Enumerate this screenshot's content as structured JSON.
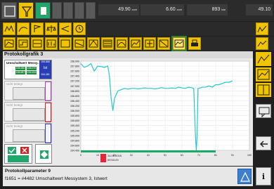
{
  "topbar": {
    "readout1": "49.90",
    "readout1_unit": "ccm",
    "readout2": "6.60",
    "readout2_unit": "ccm",
    "readout3": "893",
    "readout3_unit": "bar",
    "readout4": "49.10"
  },
  "title": "Protokollgrafik 3",
  "legend": {
    "title": "Umschaltwert Messy...",
    "v1": "155.380",
    "v2": "155.687",
    "v3": "158.570",
    "v4": "154.433",
    "badge_top": "155.888",
    "badge_mid": "Ist",
    "badge_bot": "154.481"
  },
  "cards": [
    {
      "label": "nicht belegt",
      "color": "#b03cc0"
    },
    {
      "label": "nicht belegt",
      "color": "#cc2222"
    },
    {
      "label": "nicht belegt",
      "color": "#3a3acc"
    }
  ],
  "chart": {
    "yticks": [
      "158.000",
      "157.800",
      "157.600",
      "157.400",
      "157.200",
      "157.000",
      "156.800",
      "156.600",
      "156.400",
      "156.200",
      "156.000",
      "155.800",
      "155.600",
      "155.400",
      "155.200",
      "155.000",
      "154.800",
      "154.600",
      "154.400"
    ],
    "xticks": [
      "0",
      "13",
      "21",
      "31",
      "41",
      "51",
      "61",
      "71",
      "81",
      "91",
      "100"
    ],
    "x_last": "100",
    "marker_date": "14.05.2015",
    "marker_time": "09:53:29"
  },
  "chart_data": {
    "type": "line",
    "series": [
      {
        "color": "#25c7cf",
        "x": [
          0,
          2,
          4,
          6,
          8,
          10,
          12,
          14,
          16,
          17,
          18,
          19,
          20,
          22,
          24,
          26,
          28,
          30,
          32,
          34,
          36,
          38,
          40,
          42,
          44,
          46,
          48,
          50,
          52,
          54,
          56,
          58,
          60,
          62,
          64,
          66,
          67,
          68,
          68.5,
          69,
          69.5,
          70,
          72,
          74,
          76,
          78,
          80,
          82,
          84,
          86,
          88,
          90
        ],
        "y": [
          157.9,
          157.75,
          157.8,
          157.9,
          157.6,
          157.8,
          157.78,
          157.75,
          157.8,
          157.4,
          156.5,
          156.0,
          156.5,
          156.8,
          156.85,
          156.9,
          156.87,
          156.9,
          156.9,
          156.88,
          156.9,
          156.92,
          156.9,
          156.9,
          156.88,
          156.9,
          156.93,
          156.9,
          156.9,
          156.92,
          156.9,
          156.95,
          156.92,
          156.9,
          156.95,
          156.92,
          156.9,
          155.0,
          154.4,
          155.0,
          156.9,
          156.9,
          156.95,
          156.95,
          157.0,
          156.95,
          157.05,
          157.05,
          157.1,
          157.15,
          157.15,
          157.2
        ]
      }
    ],
    "xlim": [
      0,
      100
    ],
    "ylim": [
      154.4,
      158.0
    ]
  },
  "bottom": {
    "line1": "Protokollparameter 9",
    "line2": "f1651 = #4482 Umschaltwert Messystem 3, Istwert"
  },
  "sidebar": {
    "info": "i"
  }
}
